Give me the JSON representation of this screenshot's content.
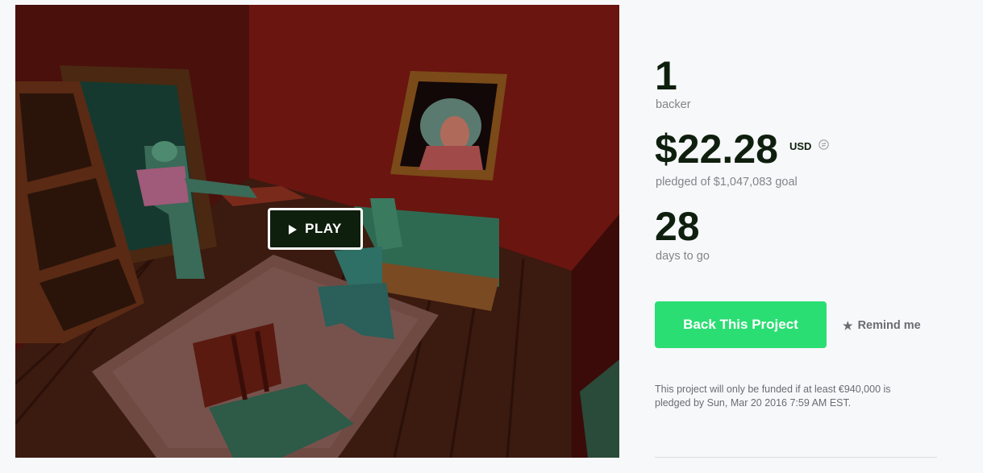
{
  "video": {
    "play_label": "PLAY"
  },
  "stats": {
    "backers_count": "1",
    "backers_label": "backer",
    "pledged_amount": "$22.28",
    "currency": "USD",
    "pledged_label": "pledged of $1,047,083 goal",
    "days_count": "28",
    "days_label": "days to go"
  },
  "actions": {
    "back_label": "Back This Project",
    "remind_label": "Remind me"
  },
  "funding_note": "This project will only be funded if at least €940,000 is pledged by Sun, Mar 20 2016 7:59 AM EST.",
  "colors": {
    "accent": "#2bde73",
    "dark": "#0f1f0e",
    "muted": "#828587",
    "background": "#f7f8fa"
  },
  "icons": {
    "play": "play-triangle",
    "currency": "currency-conversion-icon",
    "remind": "star-icon"
  }
}
